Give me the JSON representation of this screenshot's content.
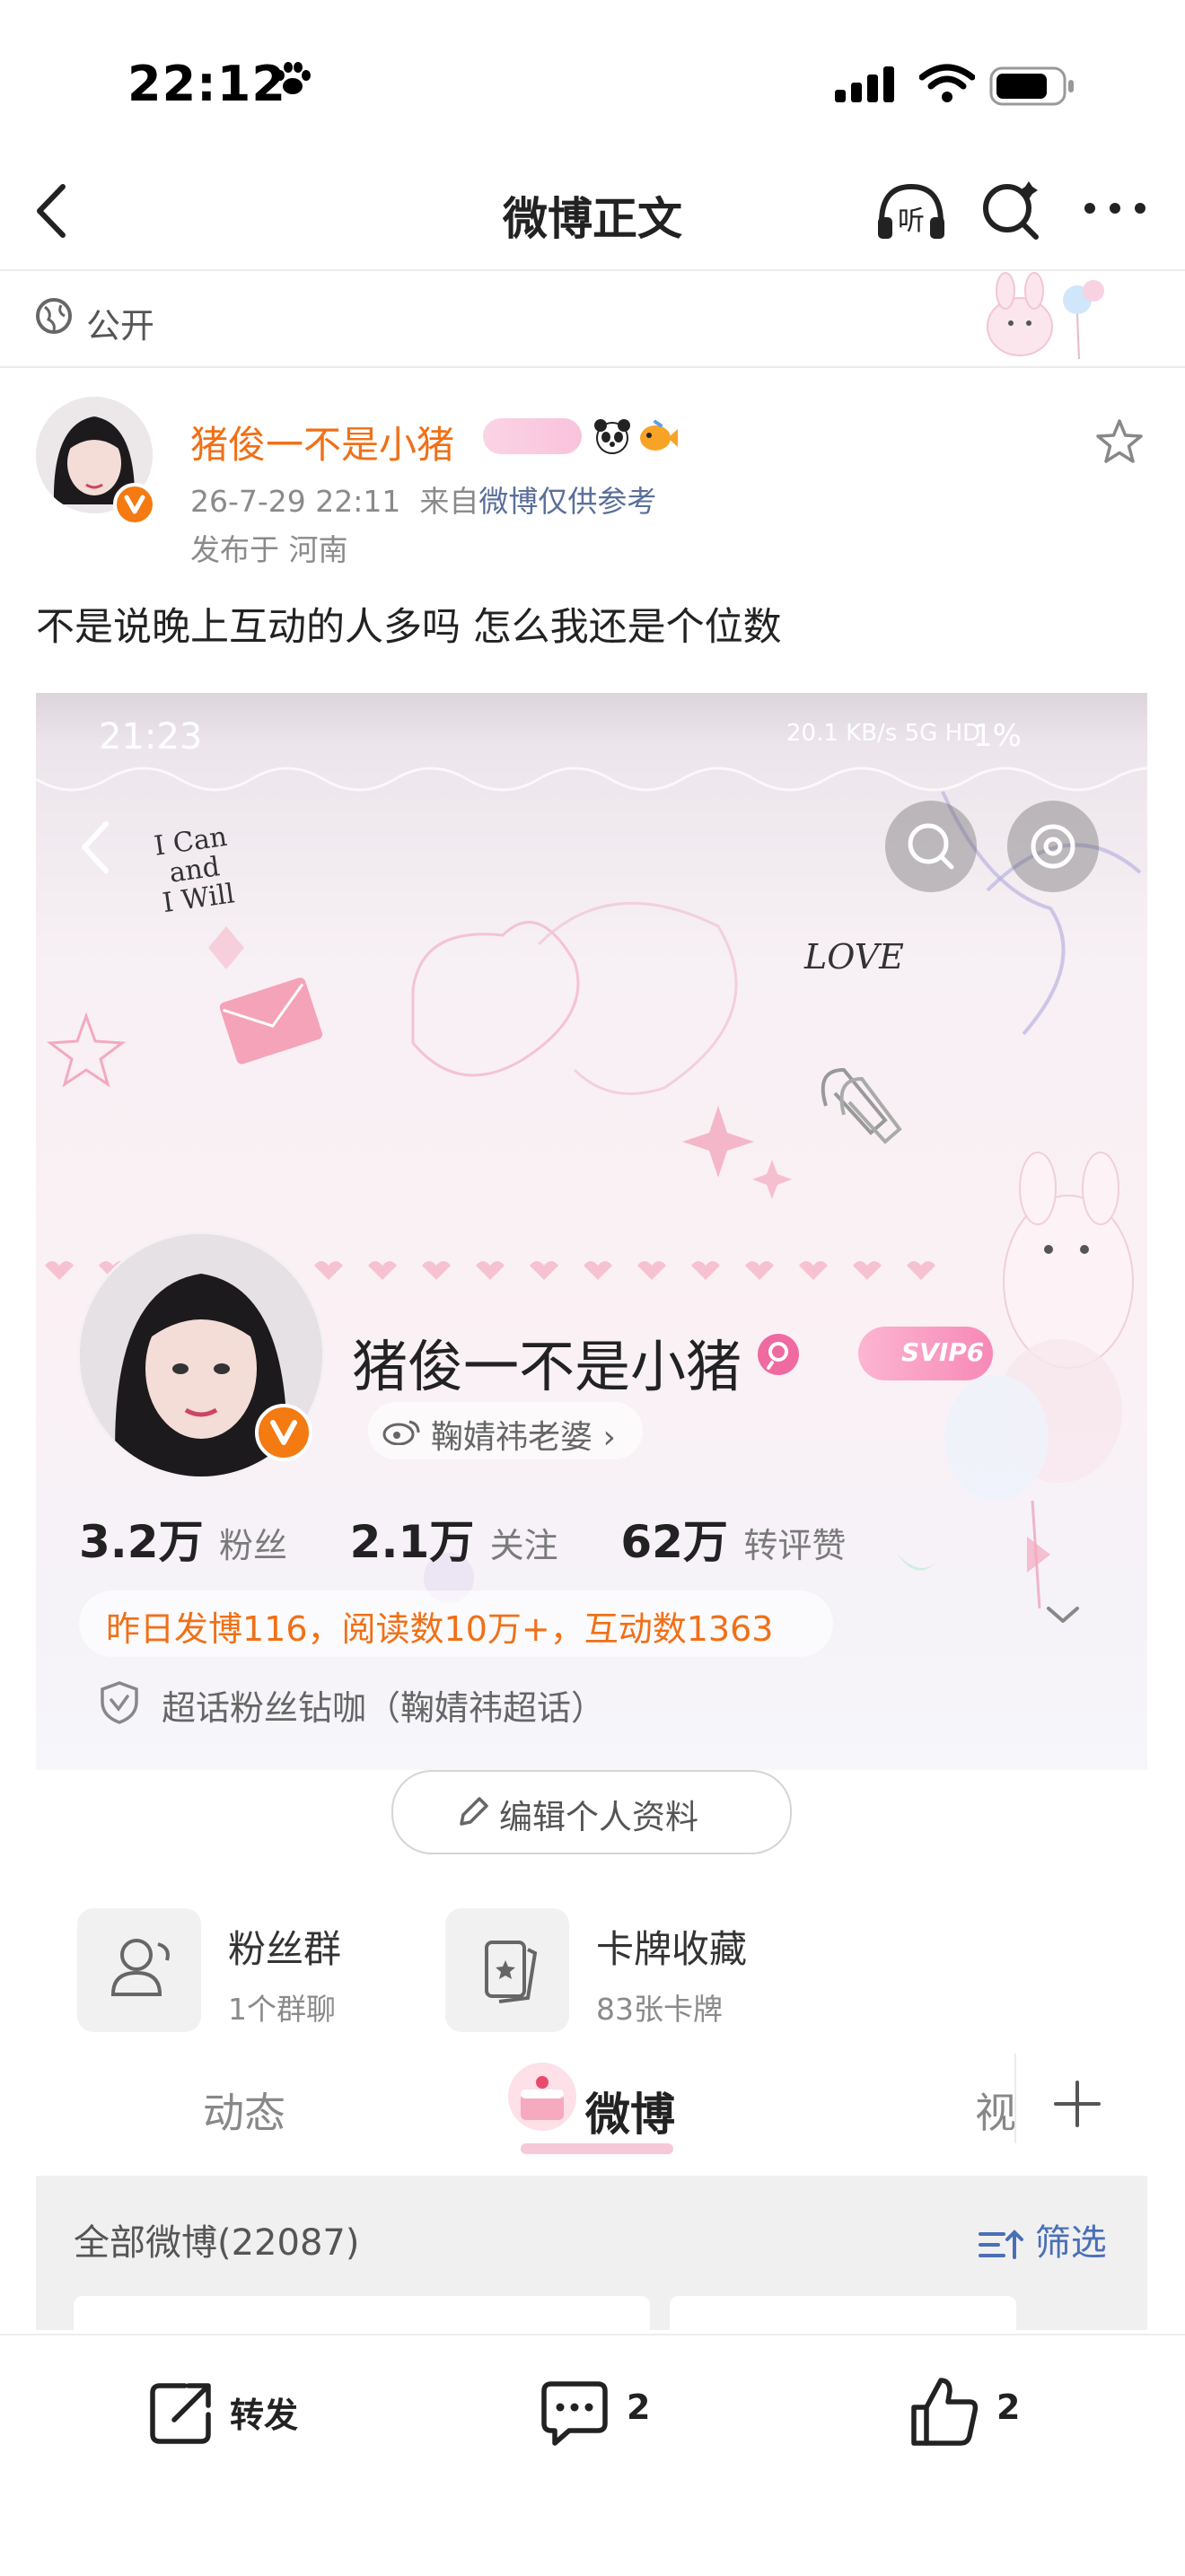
{
  "status_bar": {
    "time": "22:12"
  },
  "nav": {
    "title": "微博正文"
  },
  "visibility": {
    "label": "公开"
  },
  "post": {
    "author": "猪俊一不是小猪",
    "date": "26-7-29 22:11",
    "source_prefix": "来自",
    "source": "微博仅供参考",
    "location": "发布于 河南",
    "text": "不是说晚上互动的人多吗 怎么我还是个位数"
  },
  "screenshot": {
    "status_time": "21:23",
    "status_right": "20.1 KB/s  5G HD",
    "battery": "1%",
    "deco_love": "LOVE",
    "deco_icanwill": "I Can\nand\nI Will",
    "profile_name": "猪俊一不是小猪",
    "svip": "SVIP6",
    "supertopic_pill": "鞠婧祎老婆 ›",
    "stats": [
      {
        "value": "3.2万",
        "label": "粉丝"
      },
      {
        "value": "2.1万",
        "label": "关注"
      },
      {
        "value": "62万",
        "label": "转评赞"
      }
    ],
    "yesterday": "昨日发博116，阅读数10万+，互动数1363",
    "chaohua": "超话粉丝钻咖（鞠婧祎超话）",
    "edit_profile": "编辑个人资料",
    "fans_group": {
      "title": "粉丝群",
      "sub": "1个群聊"
    },
    "card_collect": {
      "title": "卡牌收藏",
      "sub": "83张卡牌"
    },
    "tabs": {
      "dynamic": "动态",
      "weibo": "微博",
      "video": "视"
    },
    "filter_all": "全部微博(22087)",
    "filter_btn": "筛选"
  },
  "actions": {
    "repost": "转发",
    "comments": "2",
    "likes": "2"
  },
  "colors": {
    "accent_orange": "#f07017",
    "link_blue": "#5a6f9a"
  }
}
